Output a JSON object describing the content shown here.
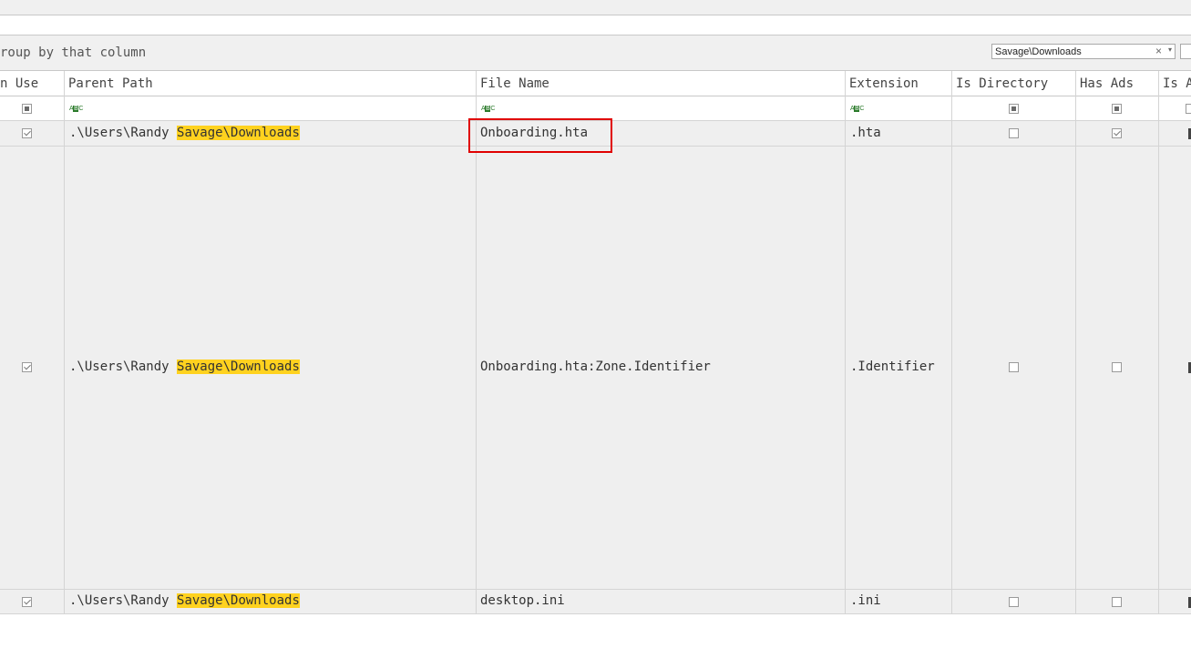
{
  "toolbar": {
    "group_hint": "roup by that column",
    "search_value": "Savage\\Downloads",
    "clear_icon": "×",
    "dropdown_icon": "▾"
  },
  "columns": {
    "in_use": "n Use",
    "parent_path": "Parent Path",
    "file_name": "File Name",
    "extension": "Extension",
    "is_directory": "Is Directory",
    "has_ads": "Has Ads",
    "is_a": "Is A"
  },
  "rows": [
    {
      "in_use": true,
      "parent_path_prefix": ".\\Users\\Randy ",
      "parent_path_match": "Savage\\Downloads",
      "file_name": "Onboarding.hta",
      "extension": ".hta",
      "is_directory": false,
      "has_ads": true
    },
    {
      "in_use": true,
      "parent_path_prefix": ".\\Users\\Randy ",
      "parent_path_match": "Savage\\Downloads",
      "file_name": "Onboarding.hta:Zone.Identifier",
      "extension": ".Identifier",
      "is_directory": false,
      "has_ads": false
    },
    {
      "in_use": true,
      "parent_path_prefix": ".\\Users\\Randy ",
      "parent_path_match": "Savage\\Downloads",
      "file_name": "desktop.ini",
      "extension": ".ini",
      "is_directory": false,
      "has_ads": false
    }
  ],
  "colors": {
    "highlight": "#ffd21f",
    "focus_box": "#e00000",
    "filter_icon": "#2a7a2a"
  }
}
